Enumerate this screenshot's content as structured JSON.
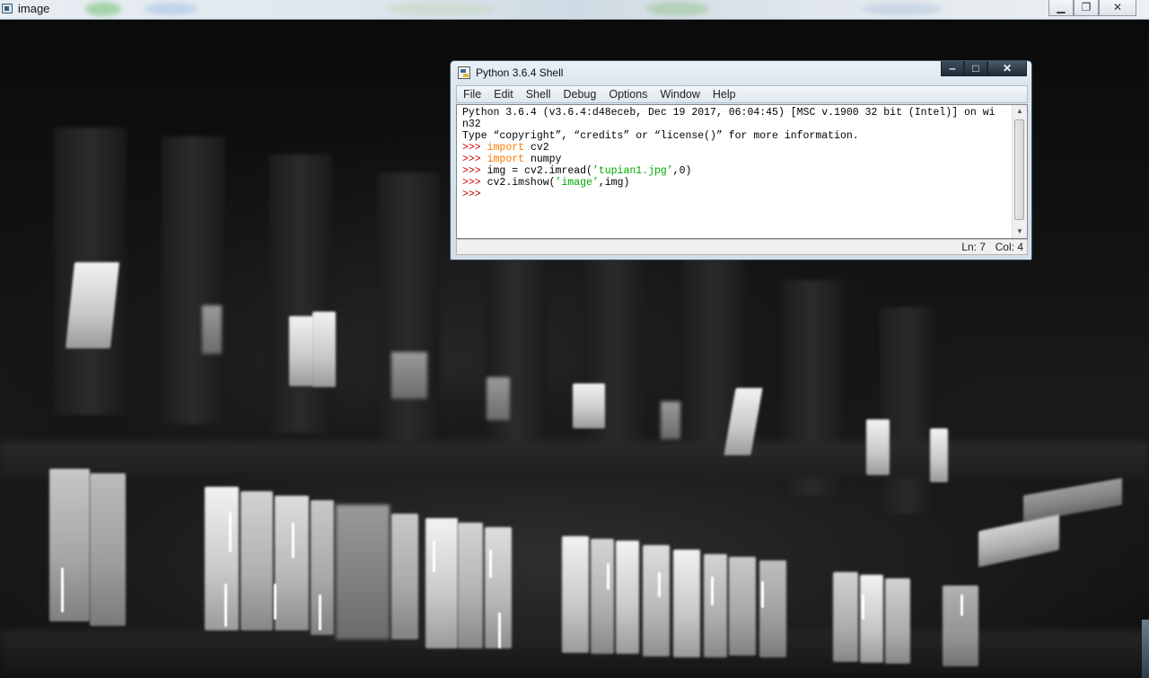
{
  "outer_window": {
    "title": "image",
    "minimize_icon": "minimize-icon",
    "restore_icon": "restore-icon",
    "close_icon": "close-icon"
  },
  "shell": {
    "title": "Python 3.6.4 Shell",
    "menu": [
      "File",
      "Edit",
      "Shell",
      "Debug",
      "Options",
      "Window",
      "Help"
    ],
    "banner_line1": "Python 3.6.4 (v3.6.4:d48eceb, Dec 19 2017, 06:04:45) [MSC v.1900 32 bit (Intel)] on wi",
    "banner_line2": "n32",
    "banner_line3": "Type “copyright”, “credits” or “license()” for more information.",
    "prompt": ">>>",
    "lines": [
      {
        "kw": "import",
        "rest": " cv2"
      },
      {
        "kw": "import",
        "rest": " numpy"
      },
      {
        "pre": "img = cv2.imread(",
        "str": "’tupian1.jpg’",
        "post": ",0)"
      },
      {
        "pre": "cv2.imshow(",
        "str": "’image’",
        "post": ",img)"
      }
    ],
    "status_ln": "Ln: 7",
    "status_col": "Col: 4"
  }
}
